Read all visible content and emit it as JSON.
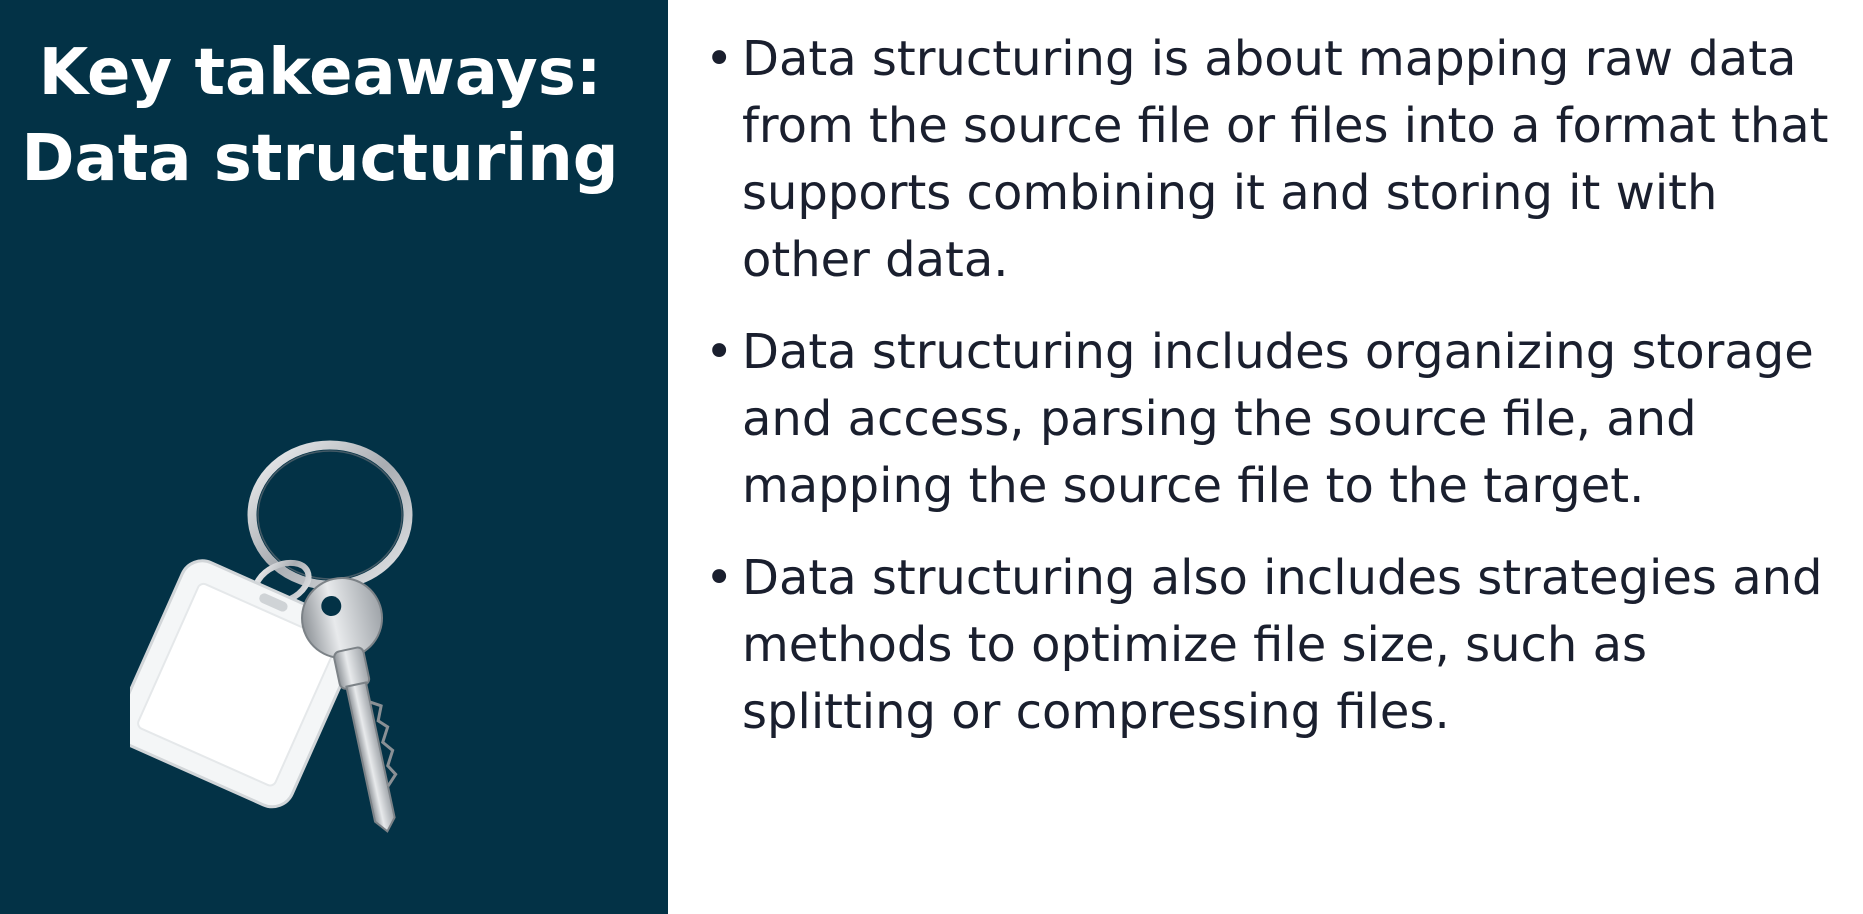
{
  "title": {
    "line1": "Key takeaways:",
    "line2": "Data structuring"
  },
  "image": {
    "icon": "keychain-icon"
  },
  "bullets": [
    {
      "marker": "•",
      "text": "Data structuring is about mapping raw data from the source file or files into a format that supports combining it and storing it with other data."
    },
    {
      "marker": "•",
      "text": "Data structuring includes organizing storage and access, parsing the source file, and mapping the source file to the target."
    },
    {
      "marker": "•",
      "text": "Data structuring also includes strategies and methods to optimize file size, such as splitting or compressing files."
    }
  ],
  "colors": {
    "panel": "#033246",
    "title_text": "#ffffff",
    "body_text": "#1a1f2e",
    "background": "#ffffff"
  }
}
